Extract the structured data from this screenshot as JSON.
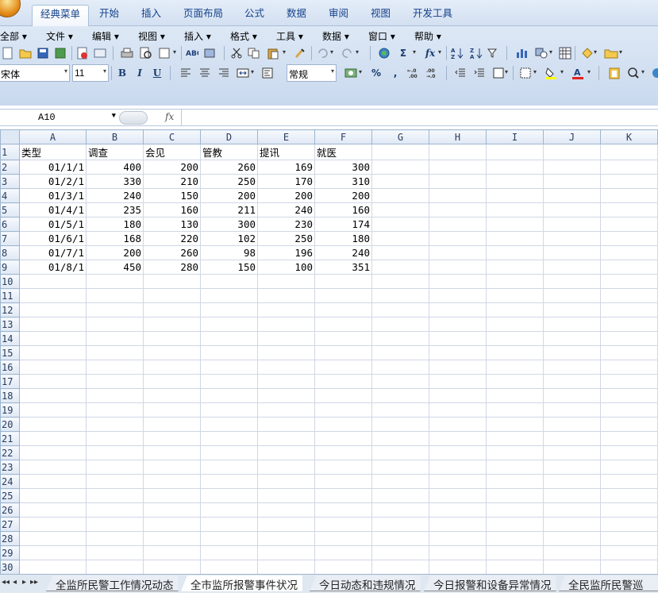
{
  "ribbon": {
    "tabs": [
      "经典菜单",
      "开始",
      "插入",
      "页面布局",
      "公式",
      "数据",
      "审阅",
      "视图",
      "开发工具"
    ],
    "active_tab": "经典菜单"
  },
  "menubar": {
    "items": [
      "全部 ▾",
      "文件 ▾",
      "编辑 ▾",
      "视图 ▾",
      "插入 ▾",
      "格式 ▾",
      "工具 ▾",
      "数据 ▾",
      "窗口 ▾",
      "帮助 ▾"
    ]
  },
  "format_bar": {
    "font_name": "宋体",
    "font_size": "11",
    "number_format": "常规",
    "bold_label": "B",
    "italic_label": "I",
    "underline_label": "U",
    "sigma_label": "Σ",
    "fx_label": "fx",
    "percent_label": "%",
    "comma_label": ","
  },
  "formula_bar": {
    "name_box": "A10",
    "fx_label": "fx",
    "content": ""
  },
  "grid": {
    "columns": [
      "A",
      "B",
      "C",
      "D",
      "E",
      "F",
      "G",
      "H",
      "I",
      "J",
      "K"
    ],
    "header_row": [
      "类型",
      "调查",
      "会见",
      "管教",
      "提讯",
      "就医"
    ],
    "rows": [
      [
        "01/1/1",
        "400",
        "200",
        "260",
        "169",
        "300"
      ],
      [
        "01/2/1",
        "330",
        "210",
        "250",
        "170",
        "310"
      ],
      [
        "01/3/1",
        "240",
        "150",
        "200",
        "200",
        "200"
      ],
      [
        "01/4/1",
        "235",
        "160",
        "211",
        "240",
        "160"
      ],
      [
        "01/5/1",
        "180",
        "130",
        "300",
        "230",
        "174"
      ],
      [
        "01/6/1",
        "168",
        "220",
        "102",
        "250",
        "180"
      ],
      [
        "01/7/1",
        "200",
        "260",
        "98",
        "196",
        "240"
      ],
      [
        "01/8/1",
        "450",
        "280",
        "150",
        "100",
        "351"
      ]
    ],
    "total_rows": 30
  },
  "sheet_tabs": {
    "tabs": [
      "全监所民警工作情况动态",
      "全市监所报警事件状况",
      "今日动态和违规情况",
      "今日报警和设备异常情况",
      "全民监所民警巡视"
    ],
    "active": "全市监所报警事件状况",
    "nav": [
      "◂◂",
      "◂",
      "▸",
      "▸▸"
    ]
  }
}
